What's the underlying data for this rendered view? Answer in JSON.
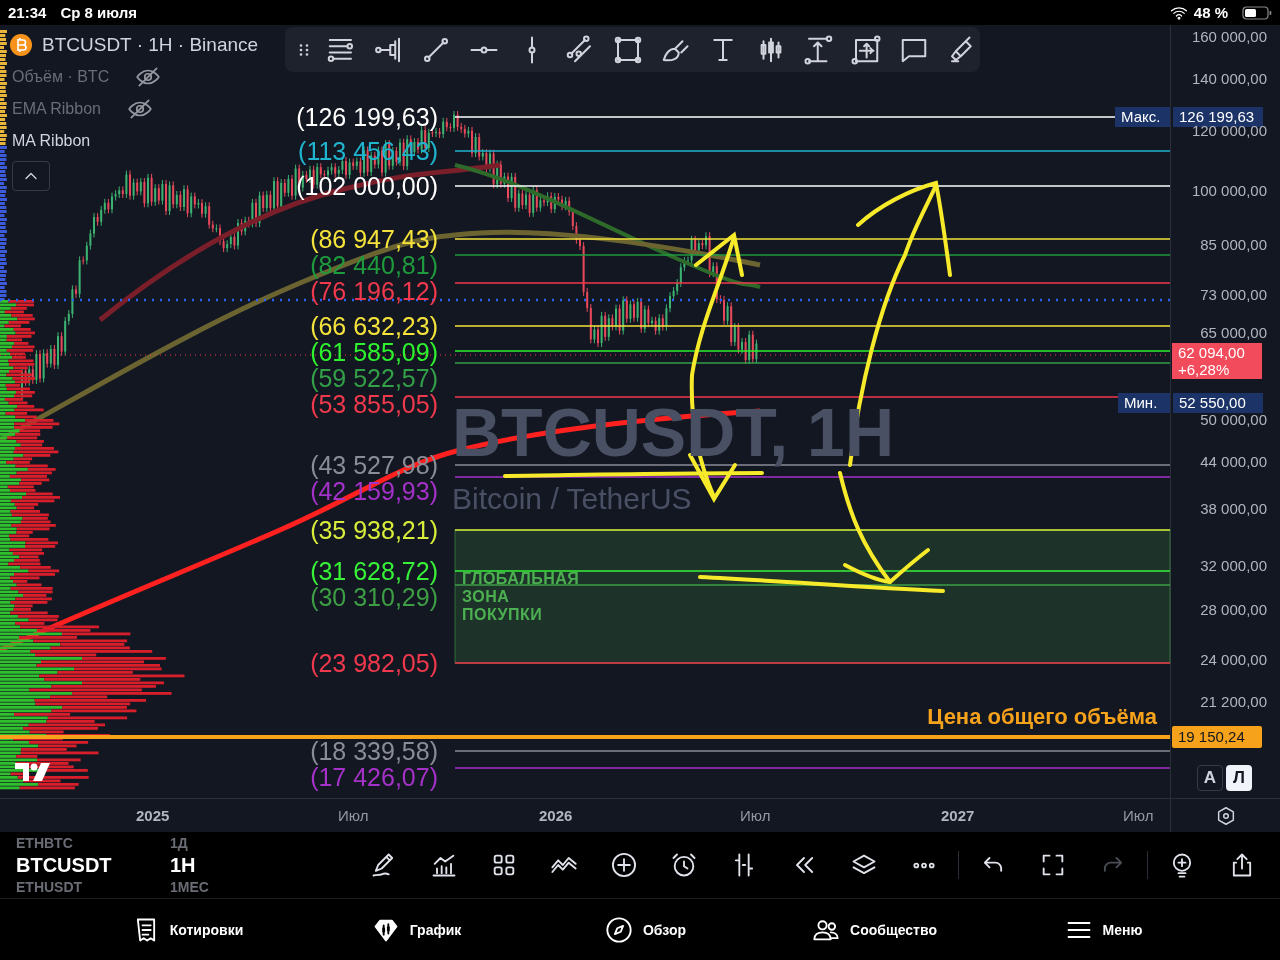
{
  "status_bar": {
    "time": "21:34",
    "date": "Ср 8 июля",
    "battery": "48 %"
  },
  "chart": {
    "legend": {
      "symbol": "BTCUSDT · 1H · Binance",
      "indicators": [
        {
          "name": "Объём · BTC",
          "hidden": true
        },
        {
          "name": "EMA Ribbon",
          "hidden": true
        },
        {
          "name": "MA Ribbon",
          "hidden": false
        }
      ]
    },
    "watermark": {
      "symbol": "BTCUSDT, 1H",
      "description": "Bitcoin / TetherUS"
    },
    "levels": [
      {
        "label": "(126 199,63)",
        "color": "#ffffff"
      },
      {
        "label": "(113 456,43)",
        "color": "#1fb5d0"
      },
      {
        "label": "(102 000,00)",
        "color": "#ffffff"
      },
      {
        "label": "(86 947,43)",
        "color": "#f5e33b"
      },
      {
        "label": "(82 440,81)",
        "color": "#1f9a3c"
      },
      {
        "label": "(76 196,12)",
        "color": "#f0394c"
      },
      {
        "label": "(66 632,23)",
        "color": "#f5e33b"
      },
      {
        "label": "(61 585,09)",
        "color": "#2ef22e"
      },
      {
        "label": "(59 522,57)",
        "color": "#33a048"
      },
      {
        "label": "(53 855,05)",
        "color": "#f0394c"
      },
      {
        "label": "(43 527,98)",
        "color": "#8a8d96"
      },
      {
        "label": "(42 159,93)",
        "color": "#a532c8"
      },
      {
        "label": "(35 938,21)",
        "color": "#d8ee3a"
      },
      {
        "label": "(31 628,72)",
        "color": "#38f238"
      },
      {
        "label": "(30 310,29)",
        "color": "#3d9e44"
      },
      {
        "label": "(23 982,05)",
        "color": "#f0394c"
      },
      {
        "label": "(18 339,58)",
        "color": "#8a8d96"
      },
      {
        "label": "(17 426,07)",
        "color": "#a532c8"
      }
    ],
    "zone": {
      "label": "ГЛОБАЛЬНАЯ\nЗОНА\nПОКУПКИ"
    },
    "volume_line": {
      "label": "Цена общего объёма",
      "price": "19 150,24"
    },
    "max_tag": {
      "caption": "Макс.",
      "price": "126 199,63"
    },
    "min_tag": {
      "caption": "Мин.",
      "price": "52 550,00"
    },
    "last_price": {
      "price": "62 094,00",
      "change": "+6,28%"
    },
    "price_axis": [
      "160 000,00",
      "140 000,00",
      "120 000,00",
      "100 000,00",
      "85 000,00",
      "73 000,00",
      "65 000,00",
      "50 000,00",
      "44 000,00",
      "38 000,00",
      "32 000,00",
      "28 000,00",
      "24 000,00",
      "21 200,00"
    ],
    "time_axis": [
      {
        "label": "2025",
        "kind": "year"
      },
      {
        "label": "Июл",
        "kind": "month"
      },
      {
        "label": "2026",
        "kind": "year"
      },
      {
        "label": "Июл",
        "kind": "month"
      },
      {
        "label": "2027",
        "kind": "year"
      },
      {
        "label": "Июл",
        "kind": "month"
      }
    ],
    "scale_buttons": [
      {
        "label": "А",
        "selected": false
      },
      {
        "label": "Л",
        "selected": true
      }
    ]
  },
  "toolbar": {
    "symbols": [
      {
        "label": "ETHBTC",
        "selected": false
      },
      {
        "label": "BTCUSDT",
        "selected": true
      },
      {
        "label": "ETHUSDT",
        "selected": false
      }
    ],
    "intervals": [
      {
        "label": "1Д",
        "selected": false
      },
      {
        "label": "1H",
        "selected": true
      },
      {
        "label": "1МЕС",
        "selected": false
      }
    ]
  },
  "tab_bar": {
    "items": [
      "Котировки",
      "График",
      "Обзор",
      "Сообщество",
      "Меню"
    ]
  }
}
